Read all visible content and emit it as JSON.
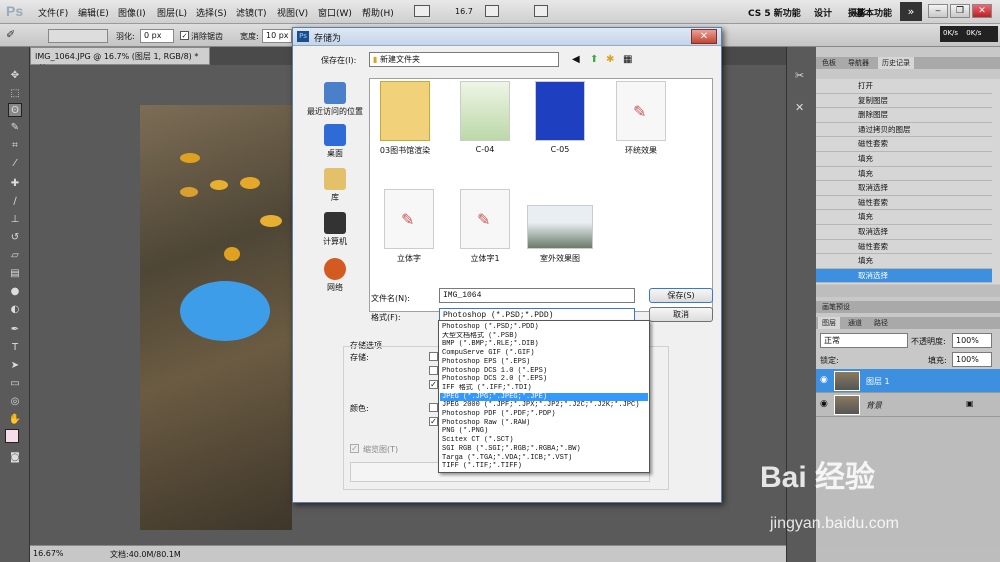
{
  "menubar": {
    "logo": "Ps",
    "items": [
      "文件(F)",
      "编辑(E)",
      "图像(I)",
      "图层(L)",
      "选择(S)",
      "滤镜(T)",
      "视图(V)",
      "窗口(W)",
      "帮助(H)"
    ],
    "zoom": "16.7",
    "workspaces": [
      "CS 5 新功能",
      "设计",
      "摄影",
      "基本功能"
    ],
    "workspace_more": "»",
    "net_speed": [
      "0K/s",
      "0K/s"
    ]
  },
  "options": {
    "feather_label": "羽化:",
    "feather_value": "0 px",
    "antialias_label": "消除锯齿",
    "width_label": "宽度:",
    "width_value": "10 px"
  },
  "document": {
    "tab": "IMG_1064.JPG @ 16.7% (图层 1, RGB/8) *",
    "close": "×",
    "zoom": "16.67%",
    "docsize": "文档:40.0M/80.1M"
  },
  "dialog": {
    "title": "存储为",
    "savein_label": "保存在(I):",
    "savein_value": "新建文件夹",
    "places": [
      {
        "label": "最近访问的位置",
        "icon": "recent-places-icon"
      },
      {
        "label": "桌面",
        "icon": "desktop-icon"
      },
      {
        "label": "库",
        "icon": "library-icon"
      },
      {
        "label": "计算机",
        "icon": "computer-icon"
      },
      {
        "label": "网络",
        "icon": "network-icon"
      }
    ],
    "files": [
      "03图书馆渲染",
      "C-04",
      "C-05",
      "环统效果",
      "立体字",
      "立体字1",
      "室外效果图"
    ],
    "filename_label": "文件名(N):",
    "filename_value": "IMG_1064",
    "format_label": "格式(F):",
    "format_value": "Photoshop (*.PSD;*.PDD)",
    "save_button": "保存(S)",
    "cancel_button": "取消",
    "storage_options_label": "存储选项",
    "storage_label": "存储:",
    "color_label": "颜色:",
    "thumbnail_label": "缩览图(T)",
    "format_options": [
      "Photoshop (*.PSD;*.PDD)",
      "大型文档格式 (*.PSB)",
      "BMP (*.BMP;*.RLE;*.DIB)",
      "CompuServe GIF (*.GIF)",
      "Photoshop EPS (*.EPS)",
      "Photoshop DCS 1.0 (*.EPS)",
      "Photoshop DCS 2.0 (*.EPS)",
      "IFF 格式 (*.IFF;*.TDI)",
      "JPEG (*.JPG;*.JPEG;*.JPE)",
      "JPEG 2000 (*.JPF;*.JPX;*.JP2;*.J2C;*.J2K;*.JPC)",
      "Photoshop PDF (*.PDF;*.PDP)",
      "Photoshop Raw (*.RAW)",
      "PNG (*.PNG)",
      "Scitex CT (*.SCT)",
      "SGI RGB (*.SGI;*.RGB;*.RGBA;*.BW)",
      "Targa (*.TGA;*.VDA;*.ICB;*.VST)",
      "TIFF (*.TIF;*.TIFF)"
    ],
    "selected_format_index": 8
  },
  "panels": {
    "top_tabs": [
      "色板",
      "导航器",
      "历史记录"
    ],
    "history": [
      "打开",
      "复制图层",
      "删除图层",
      "通过拷贝的图层",
      "磁性套索",
      "填充",
      "填充",
      "取消选择",
      "磁性套索",
      "填充",
      "取消选择",
      "磁性套索",
      "填充",
      "取消选择"
    ],
    "history_selected": 13,
    "presets_tab": "画笔预设",
    "layer_tabs": [
      "图层",
      "通道",
      "路径"
    ],
    "blend_mode": "正常",
    "opacity_label": "不透明度:",
    "opacity_value": "100%",
    "lock_label": "锁定:",
    "fill_label": "填充:",
    "fill_value": "100%",
    "layers": [
      {
        "name": "图层 1",
        "selected": true
      },
      {
        "name": "背景",
        "selected": false
      }
    ]
  },
  "watermark": {
    "text": "Bai 经验",
    "url": "jingyan.baidu.com"
  }
}
